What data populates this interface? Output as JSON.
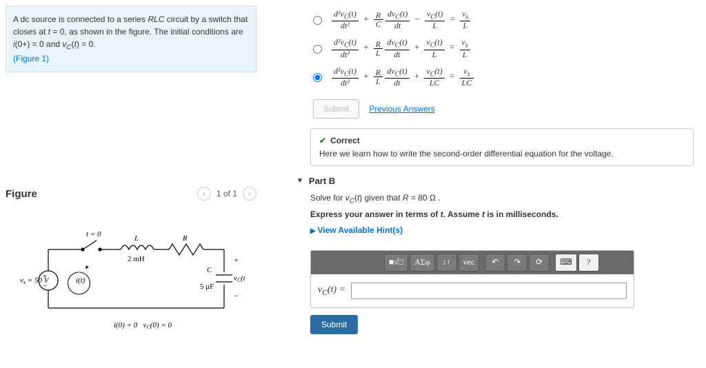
{
  "problem": {
    "statement_html": "A dc source is connected to a series <i>RLC</i> circuit by a switch that closes at <i>t</i> = 0, as shown in the figure. The initial conditions are <i>i</i>(0+) = 0 and <i>v<sub>C</sub></i>(<i>t</i>) = 0.",
    "figure_link": "(Figure 1)"
  },
  "figure": {
    "title": "Figure",
    "pager": "1 of 1",
    "vs_label": "v_s = 50 V",
    "L_label": "L",
    "L_val": "2 mH",
    "R_label": "R",
    "C_label": "C",
    "C_val": "5 μF",
    "t0": "t = 0",
    "it": "i(t)",
    "vct": "v_C(t)",
    "ic_labels": "i(0) = 0   v_C(0) = 0"
  },
  "options": {
    "opt1": {
      "selected": false
    },
    "opt2": {
      "selected": false
    },
    "opt3": {
      "selected": true
    }
  },
  "buttons": {
    "submit": "Submit",
    "prev_answers": "Previous Answers"
  },
  "feedback": {
    "correct_label": "Correct",
    "explanation": "Here we learn how to write the second-order differential equation for the voltage."
  },
  "partB": {
    "header": "Part B",
    "instruction": "Solve for v_C(t) given that R = 80 Ω .",
    "instruction2": "Express your answer in terms of t. Assume t is in milliseconds.",
    "hints_label": "View Available Hint(s)",
    "prefix": "v_C(t) =",
    "submit": "Submit"
  },
  "toolbar": {
    "templates": "■√□",
    "greek": "ΑΣφ",
    "updown": "↓↑",
    "vec": "vec",
    "undo": "↶",
    "redo": "↷",
    "reset": "⟳",
    "keyboard": "⌨",
    "help": "?"
  }
}
